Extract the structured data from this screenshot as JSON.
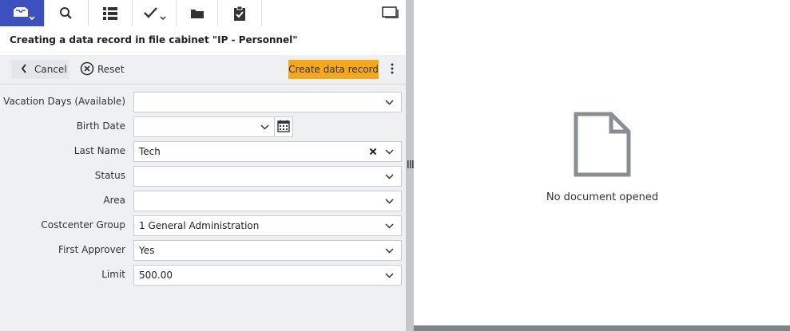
{
  "toolbar": {
    "buttons": [
      {
        "icon": "tray-icon",
        "active": true
      },
      {
        "icon": "search-icon"
      },
      {
        "icon": "list-icon"
      },
      {
        "icon": "checkmark-icon"
      },
      {
        "icon": "folder-icon"
      },
      {
        "icon": "clipboard-check-icon"
      }
    ],
    "window_icon": "window-icon"
  },
  "header": {
    "title": "Creating a data record in file cabinet \"IP - Personnel\""
  },
  "actions": {
    "cancel_label": "Cancel",
    "reset_label": "Reset",
    "create_label": "Create data record",
    "create_color": "#f5a81c"
  },
  "form": {
    "fields": [
      {
        "label": "Vacation Days (Available)",
        "value": ""
      },
      {
        "label": "Birth Date",
        "value": ""
      },
      {
        "label": "Last Name",
        "value": "Tech"
      },
      {
        "label": "Status",
        "value": ""
      },
      {
        "label": "Area",
        "value": ""
      },
      {
        "label": "Costcenter Group",
        "value": "1 General Administration"
      },
      {
        "label": "First Approver",
        "value": "Yes"
      },
      {
        "label": "Limit",
        "value": "500.00"
      }
    ]
  },
  "viewer": {
    "empty_text": "No document opened",
    "icon": "document-icon"
  },
  "colors": {
    "accent": "#3d50c0",
    "panel": "#eef0f1"
  }
}
